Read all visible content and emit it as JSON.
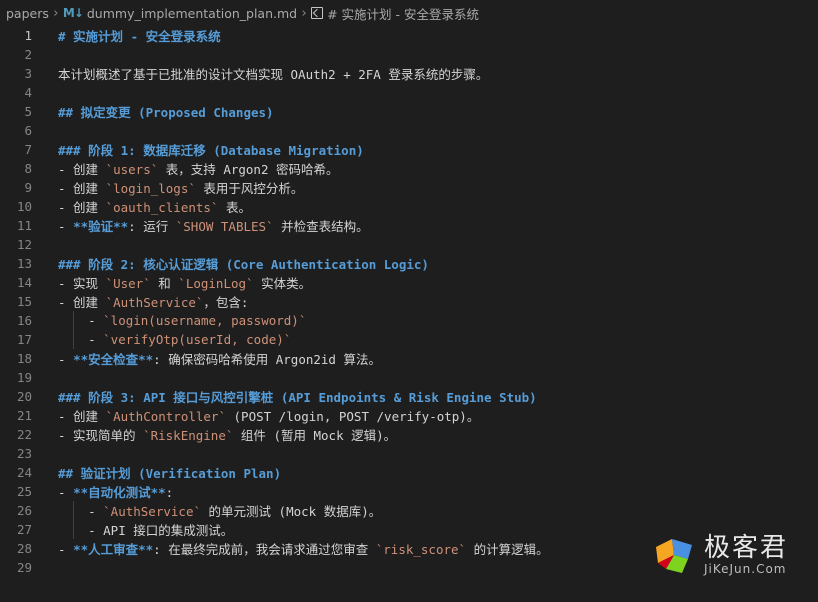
{
  "breadcrumb": {
    "folder": "papers",
    "file_icon": "M↓",
    "file": "dummy_implementation_plan.md",
    "heading": "# 实施计划 - 安全登录系统"
  },
  "editor": {
    "active_line": 1,
    "lines": [
      {
        "n": "1",
        "segs": [
          {
            "c": "heading",
            "t": "# 实施计划 - 安全登录系统"
          }
        ]
      },
      {
        "n": "2",
        "segs": []
      },
      {
        "n": "3",
        "segs": [
          {
            "c": "normal",
            "t": "本计划概述了基于已批准的设计文档实现 OAuth2 + 2FA 登录系统的步骤。"
          }
        ]
      },
      {
        "n": "4",
        "segs": []
      },
      {
        "n": "5",
        "segs": [
          {
            "c": "heading",
            "t": "## 拟定变更 (Proposed Changes)"
          }
        ]
      },
      {
        "n": "6",
        "segs": []
      },
      {
        "n": "7",
        "segs": [
          {
            "c": "heading",
            "t": "### 阶段 1: 数据库迁移 (Database Migration)"
          }
        ]
      },
      {
        "n": "8",
        "segs": [
          {
            "c": "normal",
            "t": "- 创建 "
          },
          {
            "c": "code",
            "t": "`users`"
          },
          {
            "c": "normal",
            "t": " 表，支持 Argon2 密码哈希。"
          }
        ]
      },
      {
        "n": "9",
        "segs": [
          {
            "c": "normal",
            "t": "- 创建 "
          },
          {
            "c": "code",
            "t": "`login_logs`"
          },
          {
            "c": "normal",
            "t": " 表用于风控分析。"
          }
        ]
      },
      {
        "n": "10",
        "segs": [
          {
            "c": "normal",
            "t": "- 创建 "
          },
          {
            "c": "code",
            "t": "`oauth_clients`"
          },
          {
            "c": "normal",
            "t": " 表。"
          }
        ]
      },
      {
        "n": "11",
        "segs": [
          {
            "c": "normal",
            "t": "- "
          },
          {
            "c": "bold-kw",
            "t": "**验证**"
          },
          {
            "c": "normal",
            "t": ": 运行 "
          },
          {
            "c": "code",
            "t": "`SHOW TABLES`"
          },
          {
            "c": "normal",
            "t": " 并检查表结构。"
          }
        ]
      },
      {
        "n": "12",
        "segs": []
      },
      {
        "n": "13",
        "segs": [
          {
            "c": "heading",
            "t": "### 阶段 2: 核心认证逻辑 (Core Authentication Logic)"
          }
        ]
      },
      {
        "n": "14",
        "segs": [
          {
            "c": "normal",
            "t": "- 实现 "
          },
          {
            "c": "code",
            "t": "`User`"
          },
          {
            "c": "normal",
            "t": " 和 "
          },
          {
            "c": "code",
            "t": "`LoginLog`"
          },
          {
            "c": "normal",
            "t": " 实体类。"
          }
        ]
      },
      {
        "n": "15",
        "segs": [
          {
            "c": "normal",
            "t": "- 创建 "
          },
          {
            "c": "code",
            "t": "`AuthService`"
          },
          {
            "c": "normal",
            "t": "，包含:"
          }
        ]
      },
      {
        "n": "16",
        "segs": [
          {
            "c": "normal",
            "t": "    - "
          },
          {
            "c": "code",
            "t": "`login(username, password)`"
          }
        ]
      },
      {
        "n": "17",
        "segs": [
          {
            "c": "normal",
            "t": "    - "
          },
          {
            "c": "code",
            "t": "`verifyOtp(userId, code)`"
          }
        ]
      },
      {
        "n": "18",
        "segs": [
          {
            "c": "normal",
            "t": "- "
          },
          {
            "c": "bold-kw",
            "t": "**安全检查**"
          },
          {
            "c": "normal",
            "t": ": 确保密码哈希使用 Argon2id 算法。"
          }
        ]
      },
      {
        "n": "19",
        "segs": []
      },
      {
        "n": "20",
        "segs": [
          {
            "c": "heading",
            "t": "### 阶段 3: API 接口与风控引擎桩 (API Endpoints & Risk Engine Stub)"
          }
        ]
      },
      {
        "n": "21",
        "segs": [
          {
            "c": "normal",
            "t": "- 创建 "
          },
          {
            "c": "code",
            "t": "`AuthController`"
          },
          {
            "c": "normal",
            "t": " (POST /login, POST /verify-otp)。"
          }
        ]
      },
      {
        "n": "22",
        "segs": [
          {
            "c": "normal",
            "t": "- 实现简单的 "
          },
          {
            "c": "code",
            "t": "`RiskEngine`"
          },
          {
            "c": "normal",
            "t": " 组件 (暂用 Mock 逻辑)。"
          }
        ]
      },
      {
        "n": "23",
        "segs": []
      },
      {
        "n": "24",
        "segs": [
          {
            "c": "heading",
            "t": "## 验证计划 (Verification Plan)"
          }
        ]
      },
      {
        "n": "25",
        "segs": [
          {
            "c": "normal",
            "t": "- "
          },
          {
            "c": "bold-kw",
            "t": "**自动化测试**"
          },
          {
            "c": "normal",
            "t": ":"
          }
        ]
      },
      {
        "n": "26",
        "segs": [
          {
            "c": "normal",
            "t": "    - "
          },
          {
            "c": "code",
            "t": "`AuthService`"
          },
          {
            "c": "normal",
            "t": " 的单元测试 (Mock 数据库)。"
          }
        ]
      },
      {
        "n": "27",
        "segs": [
          {
            "c": "normal",
            "t": "    - API 接口的集成测试。"
          }
        ]
      },
      {
        "n": "28",
        "segs": [
          {
            "c": "normal",
            "t": "- "
          },
          {
            "c": "bold-kw",
            "t": "**人工审查**"
          },
          {
            "c": "normal",
            "t": ": 在最终完成前，我会请求通过您审查 "
          },
          {
            "c": "code",
            "t": "`risk_score`"
          },
          {
            "c": "normal",
            "t": " 的计算逻辑。"
          }
        ]
      },
      {
        "n": "29",
        "segs": []
      }
    ]
  },
  "watermark": {
    "cn": "极客君",
    "en": "JiKeJun.Com"
  },
  "colors": {
    "background": "#1e1e1e",
    "heading": "#569cd6",
    "code": "#ce9178",
    "text": "#d4d4d4",
    "line_number": "#858585"
  }
}
